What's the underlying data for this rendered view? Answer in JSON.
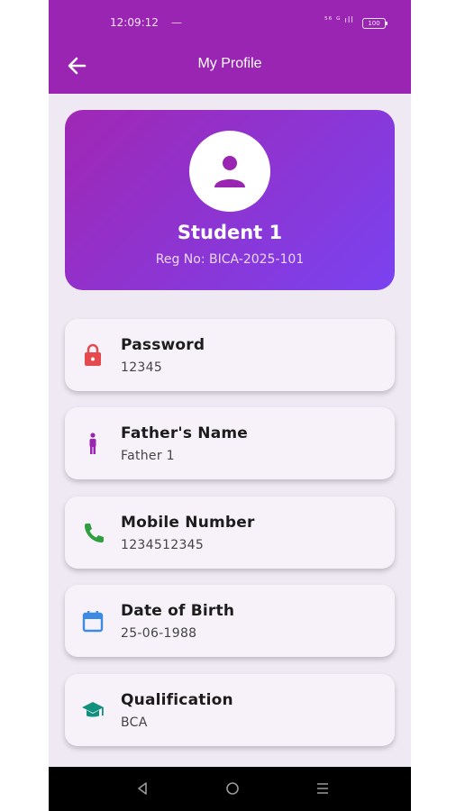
{
  "status_bar": {
    "time": "12:09:12",
    "dash": "—",
    "signal": "⁵⁶ ᴳ ıll",
    "battery": "100"
  },
  "app_bar": {
    "title": "My Profile",
    "back_icon": "arrow-left-icon"
  },
  "profile": {
    "name": "Student 1",
    "reg_no": "Reg No: BICA-2025-101",
    "avatar_icon": "person-icon"
  },
  "fields": [
    {
      "label": "Password",
      "value": "12345",
      "icon": "lock-icon",
      "color": "#e5484d"
    },
    {
      "label": "Father's Name",
      "value": "Father 1",
      "icon": "person-standing-icon",
      "color": "#9a25b3"
    },
    {
      "label": "Mobile Number",
      "value": "1234512345",
      "icon": "phone-icon",
      "color": "#2e9e3f"
    },
    {
      "label": "Date of Birth",
      "value": "25-06-1988",
      "icon": "calendar-icon",
      "color": "#3d8be0"
    },
    {
      "label": "Qualification",
      "value": "BCA",
      "icon": "graduation-cap-icon",
      "color": "#12907e"
    }
  ],
  "nav_bar": {
    "back": "back-triangle-icon",
    "home": "home-circle-icon",
    "menu": "menu-lines-icon"
  },
  "colors": {
    "primary": "#9a25b3",
    "gradient_end": "#7a42f0",
    "background": "#efe9f4"
  }
}
